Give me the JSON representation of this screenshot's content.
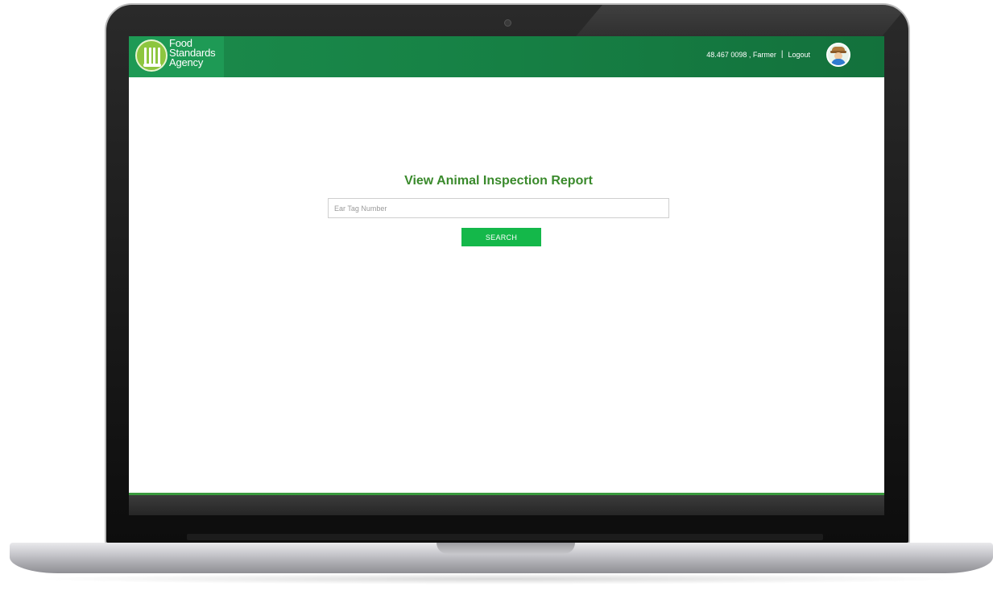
{
  "header": {
    "logo_lines": [
      "Food",
      "Standards",
      "Agency"
    ],
    "user_label": "48.467 0098 , Farmer",
    "separator": "|",
    "logout_label": "Logout"
  },
  "icons": {
    "logo": "fork-logo-icon",
    "avatar": "farmer-avatar-icon"
  },
  "main": {
    "title": "View Animal Inspection Report",
    "search_placeholder": "Ear Tag Number",
    "search_value": "",
    "search_button_label": "SEARCH"
  },
  "colors": {
    "header_green": "#178346",
    "accent_green": "#14b84a",
    "title_green": "#3a8a2c",
    "footer_dark": "#2f2f2f"
  }
}
